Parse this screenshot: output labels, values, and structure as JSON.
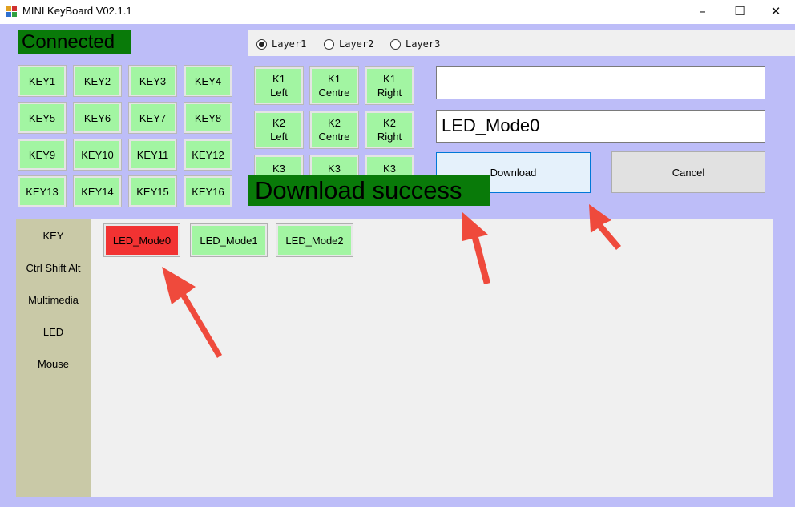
{
  "window": {
    "title": "MINI KeyBoard V02.1.1",
    "minimize": "–",
    "maximize": "☐",
    "close": "✕"
  },
  "status": "Connected",
  "layers": [
    {
      "label": "Layer1",
      "selected": true
    },
    {
      "label": "Layer2",
      "selected": false
    },
    {
      "label": "Layer3",
      "selected": false
    }
  ],
  "keys": [
    "KEY1",
    "KEY2",
    "KEY3",
    "KEY4",
    "KEY5",
    "KEY6",
    "KEY7",
    "KEY8",
    "KEY9",
    "KEY10",
    "KEY11",
    "KEY12",
    "KEY13",
    "KEY14",
    "KEY15",
    "KEY16"
  ],
  "knobs": [
    {
      "line1": "K1",
      "line2": "Left"
    },
    {
      "line1": "K1",
      "line2": "Centre"
    },
    {
      "line1": "K1",
      "line2": "Right"
    },
    {
      "line1": "K2",
      "line2": "Left"
    },
    {
      "line1": "K2",
      "line2": "Centre"
    },
    {
      "line1": "K2",
      "line2": "Right"
    },
    {
      "line1": "K3",
      "line2": ""
    },
    {
      "line1": "K3",
      "line2": ""
    },
    {
      "line1": "K3",
      "line2": ""
    }
  ],
  "fields": {
    "top_value": "",
    "mode_value": "LED_Mode0"
  },
  "buttons": {
    "download": "Download",
    "cancel": "Cancel"
  },
  "toast": "Download success",
  "sidebar": [
    "KEY",
    "Ctrl Shift Alt",
    "Multimedia",
    "LED",
    "Mouse"
  ],
  "led_modes": [
    {
      "label": "LED_Mode0",
      "active": true
    },
    {
      "label": "LED_Mode1",
      "active": false
    },
    {
      "label": "LED_Mode2",
      "active": false
    }
  ],
  "colors": {
    "key_bg": "#a2f5a2",
    "active_mode": "#f23232",
    "status_bg": "#097a09",
    "annotation_arrow": "#ef4a3c"
  }
}
